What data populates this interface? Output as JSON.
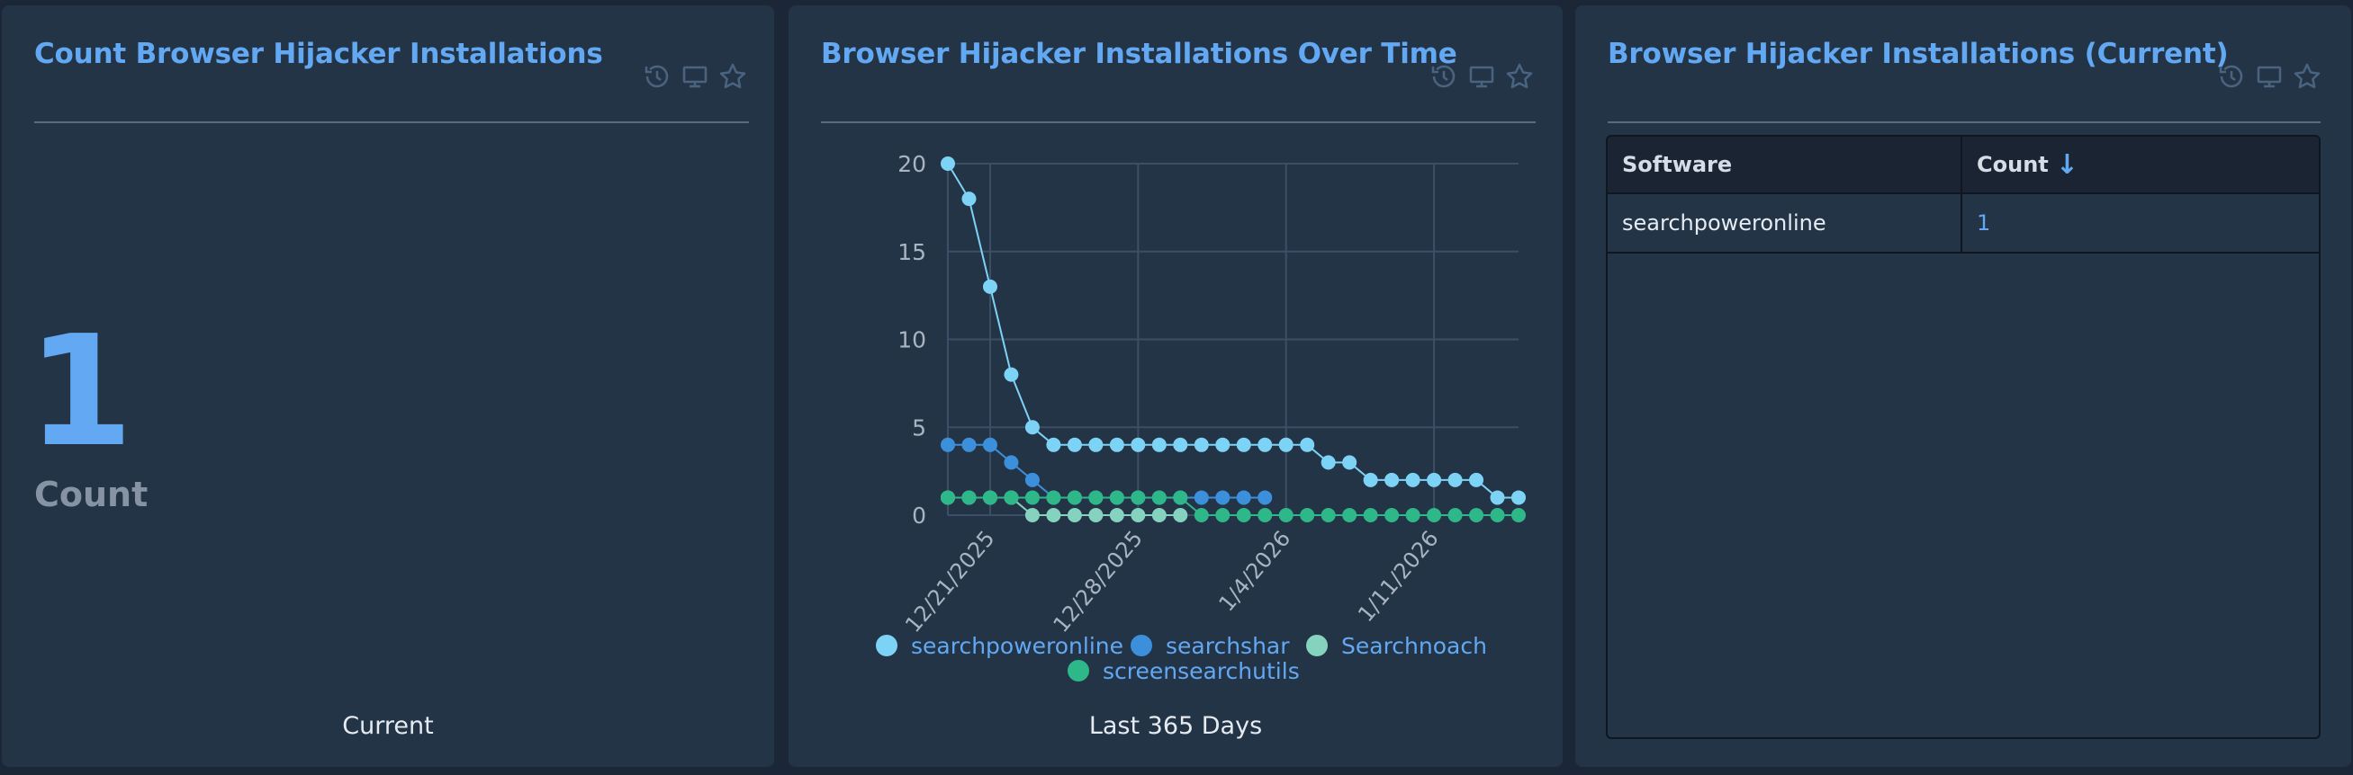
{
  "panels": [
    {
      "title": "Count Browser Hijacker Installations",
      "value": "1",
      "value_label": "Count",
      "footer": "Current"
    },
    {
      "title": "Browser Hijacker Installations Over Time",
      "footer": "Last 365 Days"
    },
    {
      "title": "Browser Hijacker Installations (Current)"
    }
  ],
  "icons": [
    "refresh-clock-icon",
    "monitor-icon",
    "star-icon"
  ],
  "colors": {
    "accent": "#62a8f2",
    "background": "#1b2636",
    "panel": "#243447"
  },
  "table": {
    "columns": [
      "Software",
      "Count"
    ],
    "sort": {
      "column": "Count",
      "direction": "descending"
    },
    "rows": [
      {
        "software": "searchpoweronline",
        "count": "1"
      }
    ]
  },
  "chart_data": {
    "type": "line",
    "x_ticks": [
      "12/21/2025",
      "12/28/2025",
      "1/4/2026",
      "1/11/2026"
    ],
    "x_tick_dates": [
      "2025-12-21",
      "2025-12-28",
      "2026-01-04",
      "2026-01-11"
    ],
    "y_ticks": [
      0,
      5,
      10,
      15,
      20
    ],
    "ylim": [
      0,
      20
    ],
    "grid": true,
    "legend_position": "bottom",
    "x": [
      "2025-12-19",
      "2025-12-20",
      "2025-12-21",
      "2025-12-22",
      "2025-12-23",
      "2025-12-24",
      "2025-12-25",
      "2025-12-26",
      "2025-12-27",
      "2025-12-28",
      "2025-12-29",
      "2025-12-30",
      "2025-12-31",
      "2026-01-01",
      "2026-01-02",
      "2026-01-03",
      "2026-01-04",
      "2026-01-05",
      "2026-01-06",
      "2026-01-07",
      "2026-01-08",
      "2026-01-09",
      "2026-01-10",
      "2026-01-11",
      "2026-01-12",
      "2026-01-13",
      "2026-01-14",
      "2026-01-15"
    ],
    "series": [
      {
        "name": "searchpoweronline",
        "color": "#7dd3f5",
        "values": [
          20,
          18,
          13,
          8,
          5,
          4,
          4,
          4,
          4,
          4,
          4,
          4,
          4,
          4,
          4,
          4,
          4,
          4,
          3,
          3,
          2,
          2,
          2,
          2,
          2,
          2,
          1,
          1
        ]
      },
      {
        "name": "searchshar",
        "color": "#3b8fdb",
        "values": [
          4,
          4,
          4,
          3,
          2,
          1,
          1,
          1,
          1,
          1,
          1,
          1,
          1,
          1,
          1,
          1
        ]
      },
      {
        "name": "Searchnoach",
        "color": "#85d3be",
        "values": [
          1,
          1,
          1,
          1,
          0,
          0,
          0,
          0,
          0,
          0,
          0,
          0
        ]
      },
      {
        "name": "screensearchutils",
        "color": "#2eb88a",
        "values": [
          1,
          1,
          1,
          1,
          1,
          1,
          1,
          1,
          1,
          1,
          1,
          1,
          0,
          0,
          0,
          0,
          0,
          0,
          0,
          0,
          0,
          0,
          0,
          0,
          0,
          0,
          0,
          0
        ]
      }
    ]
  }
}
